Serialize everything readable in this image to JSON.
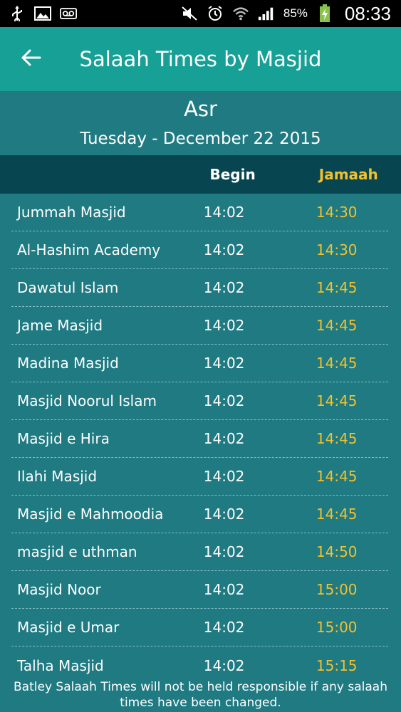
{
  "status_bar": {
    "battery_text": "85%",
    "time": "08:33"
  },
  "app_bar": {
    "title": "Salaah Times by Masjid"
  },
  "header": {
    "prayer": "Asr",
    "date": "Tuesday - December 22 2015"
  },
  "columns": {
    "begin": "Begin",
    "jamaah": "Jamaah"
  },
  "rows": [
    {
      "name": "Jummah Masjid",
      "begin": "14:02",
      "jamaah": "14:30"
    },
    {
      "name": "Al-Hashim Academy",
      "begin": "14:02",
      "jamaah": "14:30"
    },
    {
      "name": "Dawatul Islam",
      "begin": "14:02",
      "jamaah": "14:45"
    },
    {
      "name": "Jame Masjid",
      "begin": "14:02",
      "jamaah": "14:45"
    },
    {
      "name": "Madina Masjid",
      "begin": "14:02",
      "jamaah": "14:45"
    },
    {
      "name": "Masjid Noorul Islam",
      "begin": "14:02",
      "jamaah": "14:45"
    },
    {
      "name": "Masjid e Hira",
      "begin": "14:02",
      "jamaah": "14:45"
    },
    {
      "name": "Ilahi Masjid",
      "begin": "14:02",
      "jamaah": "14:45"
    },
    {
      "name": "Masjid e Mahmoodia",
      "begin": "14:02",
      "jamaah": "14:45"
    },
    {
      "name": "masjid e uthman",
      "begin": "14:02",
      "jamaah": "14:50"
    },
    {
      "name": "Masjid Noor",
      "begin": "14:02",
      "jamaah": "15:00"
    },
    {
      "name": "Masjid e Umar",
      "begin": "14:02",
      "jamaah": "15:00"
    },
    {
      "name": "Talha Masjid",
      "begin": "14:02",
      "jamaah": "15:15"
    }
  ],
  "footer": {
    "disclaimer": "Batley Salaah Times will not be held responsible if any salaah times have been changed."
  },
  "colors": {
    "appbar": "#17a095",
    "background": "#1f7a82",
    "column_header": "#074650",
    "jamaah_accent": "#f2c12e"
  }
}
